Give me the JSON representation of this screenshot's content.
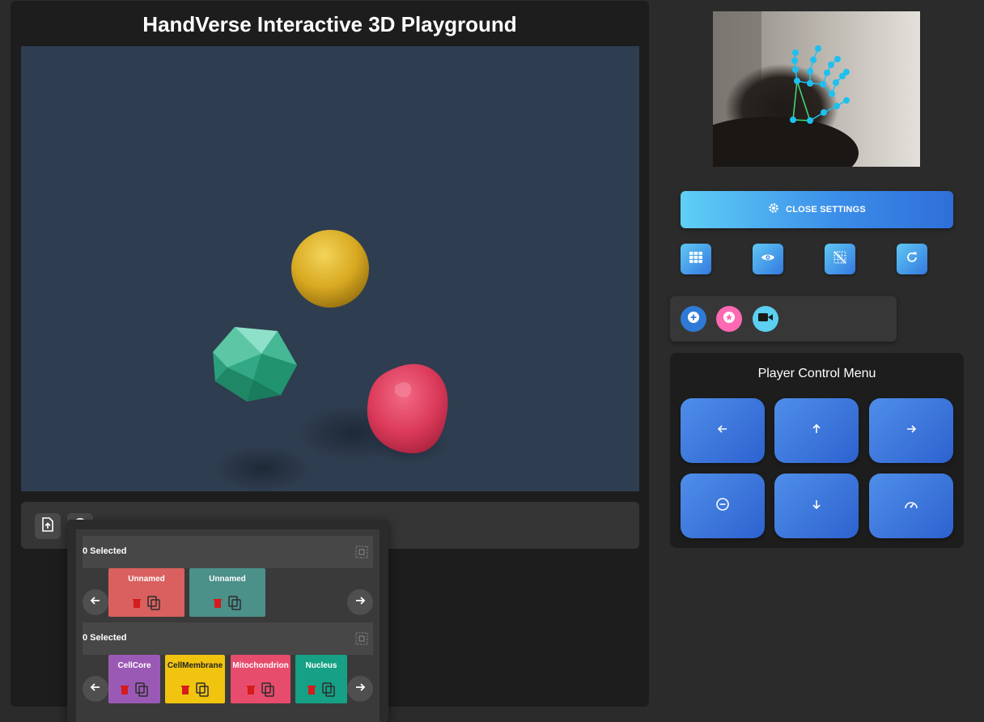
{
  "app": {
    "title": "HandVerse Interactive 3D Playground"
  },
  "toolbar": {
    "buttons": [
      {
        "icon": "file-upload-icon"
      },
      {
        "icon": "help-icon"
      }
    ]
  },
  "palette": {
    "rows": [
      {
        "selected_text": "0 Selected",
        "cards": [
          {
            "label": "Unnamed",
            "color": "#d9605e",
            "text_color": "#ffffff"
          },
          {
            "label": "Unnamed",
            "color": "#4b9089",
            "text_color": "#ffffff"
          }
        ]
      },
      {
        "selected_text": "0 Selected",
        "cards": [
          {
            "label": "CellCore",
            "color": "#9b59b6",
            "text_color": "#ffffff"
          },
          {
            "label": "CellMembrane",
            "color": "#f1c40f",
            "text_color": "#222222"
          },
          {
            "label": "Mitochondrion",
            "color": "#e74c6c",
            "text_color": "#ffffff"
          },
          {
            "label": "Nucleus",
            "color": "#16a085",
            "text_color": "#ffffff"
          }
        ]
      }
    ]
  },
  "settings": {
    "close_label": "CLOSE SETTINGS",
    "icon_buttons": [
      {
        "icon": "grid-icon"
      },
      {
        "icon": "eye-icon"
      },
      {
        "icon": "grid-off-icon"
      },
      {
        "icon": "refresh-icon"
      }
    ]
  },
  "creation": {
    "buttons": [
      {
        "icon": "add-circle-icon",
        "color": "#2e7ad6"
      },
      {
        "icon": "star-circle-icon",
        "color": "#ff69b4"
      },
      {
        "icon": "video-camera-icon",
        "color": "#5bd0f0"
      }
    ]
  },
  "player_menu": {
    "title": "Player Control Menu",
    "buttons": [
      {
        "icon": "arrow-left-icon"
      },
      {
        "icon": "arrow-up-icon"
      },
      {
        "icon": "arrow-right-icon"
      },
      {
        "icon": "zoom-out-icon"
      },
      {
        "icon": "arrow-down-icon"
      },
      {
        "icon": "speed-icon"
      }
    ]
  },
  "colors": {
    "panel_bg": "#1d1d1d",
    "viewport_bg": "#2f3d50",
    "accent_blue": "#3a7be0",
    "sphere_yellow": "#e3b52c",
    "icosahedron_teal": "#2fa883",
    "blob_pink": "#e0405e",
    "hand_landmark": "#1ec0f0",
    "hand_connection": "#3ee07a"
  }
}
